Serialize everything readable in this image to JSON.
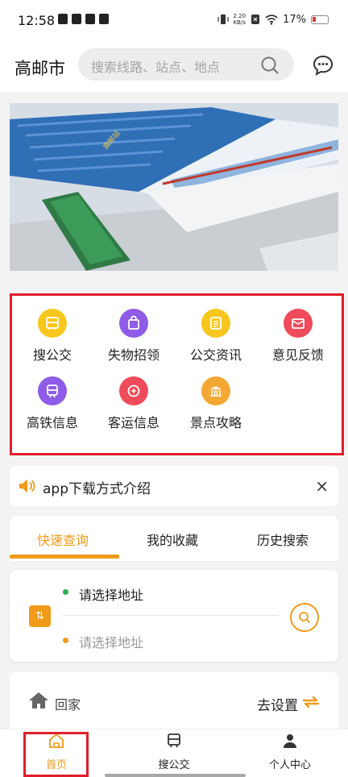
{
  "status_bar": {
    "time": "12:58",
    "net_speed": "2.20",
    "net_unit": "KB/s",
    "battery": "17%"
  },
  "header": {
    "city": "高邮市",
    "search_placeholder": "搜索线路、站点、地点"
  },
  "banner": {
    "building_sign": "高邮站"
  },
  "services": [
    {
      "label": "搜公交",
      "icon": "bus-search-icon",
      "color": "#f7c71e"
    },
    {
      "label": "失物招领",
      "icon": "bag-icon",
      "color": "#8e5ce6"
    },
    {
      "label": "公交资讯",
      "icon": "news-icon",
      "color": "#f7c71e"
    },
    {
      "label": "意见反馈",
      "icon": "feedback-icon",
      "color": "#ef4b5b"
    },
    {
      "label": "高铁信息",
      "icon": "train-icon",
      "color": "#8e5ce6"
    },
    {
      "label": "客运信息",
      "icon": "coach-icon",
      "color": "#ef4b5b"
    },
    {
      "label": "景点攻略",
      "icon": "temple-icon",
      "color": "#f3a833"
    }
  ],
  "notice": {
    "text": "app下载方式介绍",
    "close": "×"
  },
  "tabs": [
    {
      "label": "快速查询"
    },
    {
      "label": "我的收藏"
    },
    {
      "label": "历史搜索"
    }
  ],
  "query": {
    "from_placeholder": "请选择地址",
    "to_placeholder": "请选择地址",
    "swap_icon": "⇅"
  },
  "home_shortcut": {
    "label": "回家",
    "action": "去设置"
  },
  "nav": [
    {
      "label": "首页"
    },
    {
      "label": "搜公交"
    },
    {
      "label": "个人中心"
    }
  ],
  "colors": {
    "accent": "#f09a19",
    "highlight_box": "#e01e2b"
  }
}
